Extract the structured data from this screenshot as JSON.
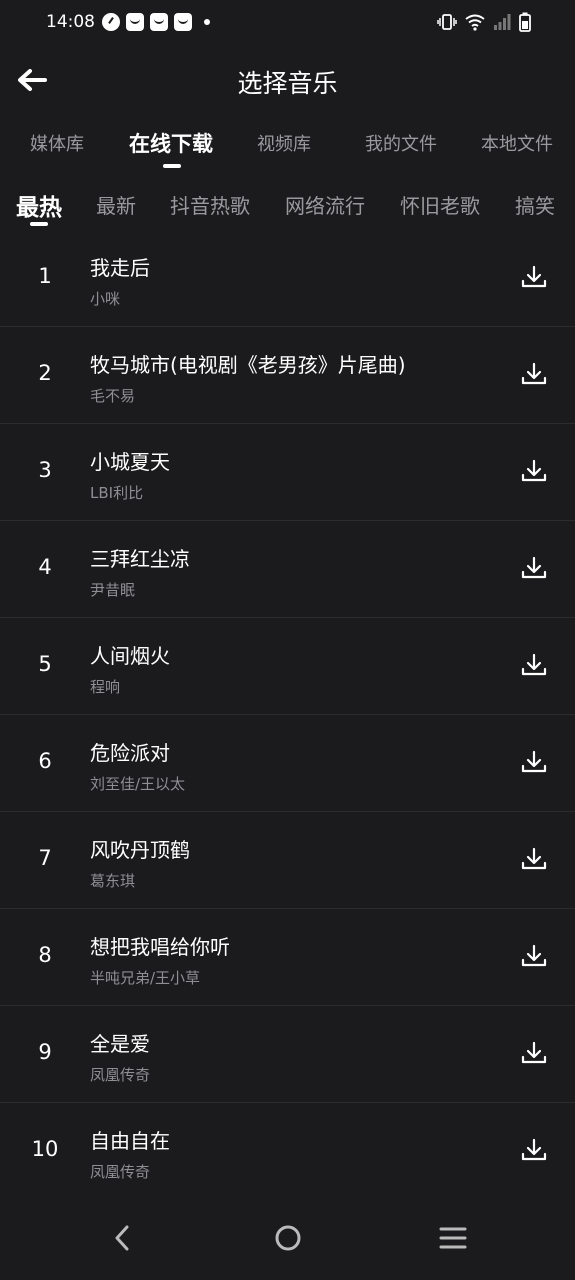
{
  "status_bar": {
    "time": "14:08",
    "icons": [
      "clock-app-icon",
      "bag-icon",
      "bag-icon",
      "bag-icon",
      "vibrate-icon",
      "wifi-icon",
      "signal-icon",
      "battery-icon"
    ]
  },
  "header": {
    "title": "选择音乐"
  },
  "main_tabs": [
    {
      "label": "媒体库",
      "active": false
    },
    {
      "label": "在线下载",
      "active": true
    },
    {
      "label": "视频库",
      "active": false
    },
    {
      "label": "我的文件",
      "active": false
    },
    {
      "label": "本地文件",
      "active": false
    }
  ],
  "category_tabs": [
    {
      "label": "最热",
      "active": true
    },
    {
      "label": "最新",
      "active": false
    },
    {
      "label": "抖音热歌",
      "active": false
    },
    {
      "label": "网络流行",
      "active": false
    },
    {
      "label": "怀旧老歌",
      "active": false
    },
    {
      "label": "搞笑",
      "active": false
    }
  ],
  "songs": [
    {
      "rank": "1",
      "title": "我走后",
      "artist": "小咪"
    },
    {
      "rank": "2",
      "title": "牧马城市(电视剧《老男孩》片尾曲)",
      "artist": "毛不易"
    },
    {
      "rank": "3",
      "title": "小城夏天",
      "artist": "LBI利比"
    },
    {
      "rank": "4",
      "title": "三拜红尘凉",
      "artist": "尹昔眠"
    },
    {
      "rank": "5",
      "title": "人间烟火",
      "artist": "程响"
    },
    {
      "rank": "6",
      "title": "危险派对",
      "artist": "刘至佳/王以太"
    },
    {
      "rank": "7",
      "title": "风吹丹顶鹤",
      "artist": "葛东琪"
    },
    {
      "rank": "8",
      "title": "想把我唱给你听",
      "artist": "半吨兄弟/王小草"
    },
    {
      "rank": "9",
      "title": "全是爱",
      "artist": "凤凰传奇"
    },
    {
      "rank": "10",
      "title": "自由自在",
      "artist": "凤凰传奇"
    }
  ],
  "colors": {
    "background": "#1b1b1d",
    "text_primary": "#ffffff",
    "text_secondary": "#8e8e93",
    "divider": "#2c2c2e"
  }
}
